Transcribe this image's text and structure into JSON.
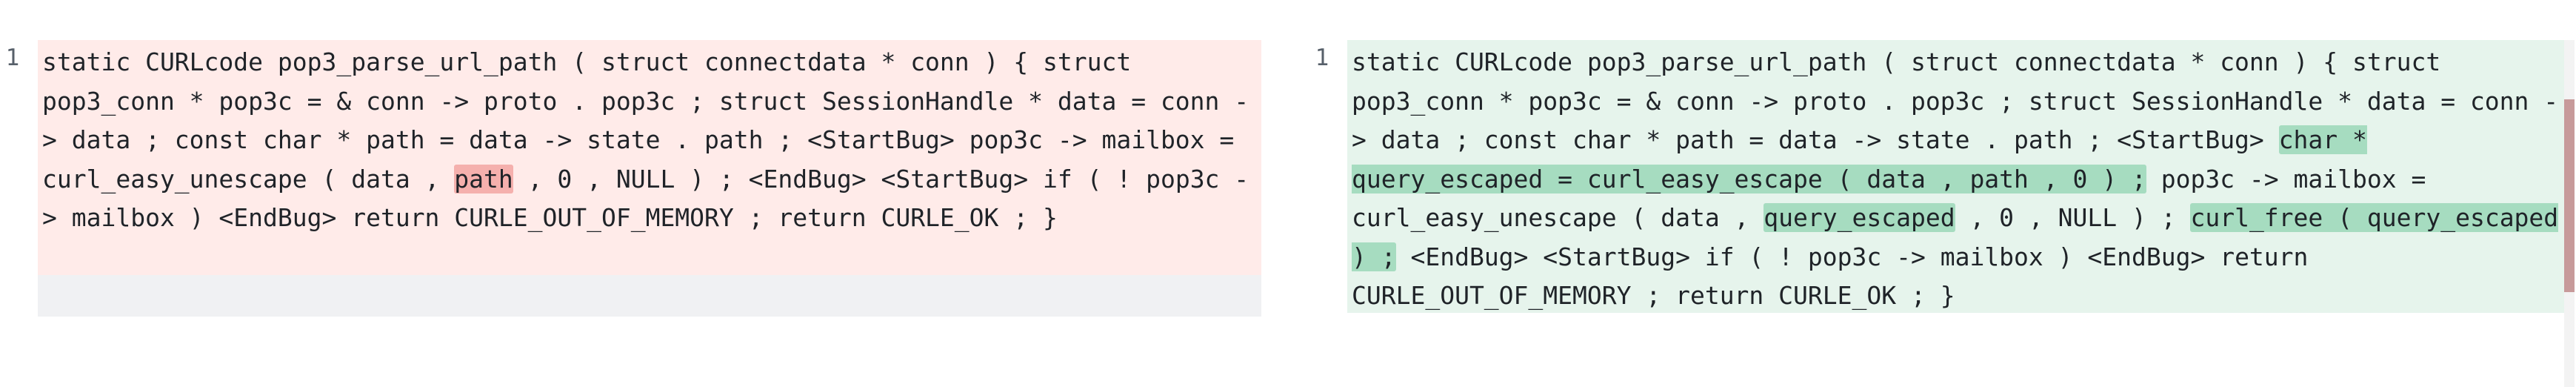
{
  "left": {
    "line_number": "1",
    "segments": [
      {
        "text": "static CURLcode pop3_parse_url_path ( struct connectdata * conn ) { struct pop3_conn * pop3c = & conn -> proto . pop3c ; struct SessionHandle * data = conn -> data ; const char * path = data -> state . path ; <StartBug> pop3c -> mailbox = curl_easy_unescape ( data , ",
        "hl": false
      },
      {
        "text": "path",
        "hl": true
      },
      {
        "text": " , 0 , NULL ) ; <EndBug> <StartBug> if ( ! pop3c -> mailbox ) <EndBug> return CURLE_OUT_OF_MEMORY ; return CURLE_OK ; }",
        "hl": false
      }
    ]
  },
  "right": {
    "line_number": "1",
    "segments": [
      {
        "text": "static CURLcode pop3_parse_url_path ( struct connectdata * conn ) { struct pop3_conn * pop3c = & conn -> proto . pop3c ; struct SessionHandle * data = conn -> data ; const char * path = data -> state . path ; <StartBug> ",
        "hl": false
      },
      {
        "text": "char * query_escaped = curl_easy_escape ( data , path , 0 ) ;",
        "hl": true
      },
      {
        "text": " pop3c -> mailbox = curl_easy_unescape ( data , ",
        "hl": false
      },
      {
        "text": "query_escaped",
        "hl": true
      },
      {
        "text": " , 0 , NULL ) ; ",
        "hl": false
      },
      {
        "text": "curl_free ( query_escaped ) ;",
        "hl": true
      },
      {
        "text": " <EndBug> <StartBug> if ( ! pop3c -> mailbox ) <EndBug> return CURLE_OUT_OF_MEMORY ; return CURLE_OK ; }",
        "hl": false
      }
    ]
  },
  "colors": {
    "deleted_bg": "#ffebe9",
    "deleted_highlight": "#f5b0ad",
    "added_bg": "#e6f4ec",
    "added_highlight": "#a6dcc0"
  }
}
